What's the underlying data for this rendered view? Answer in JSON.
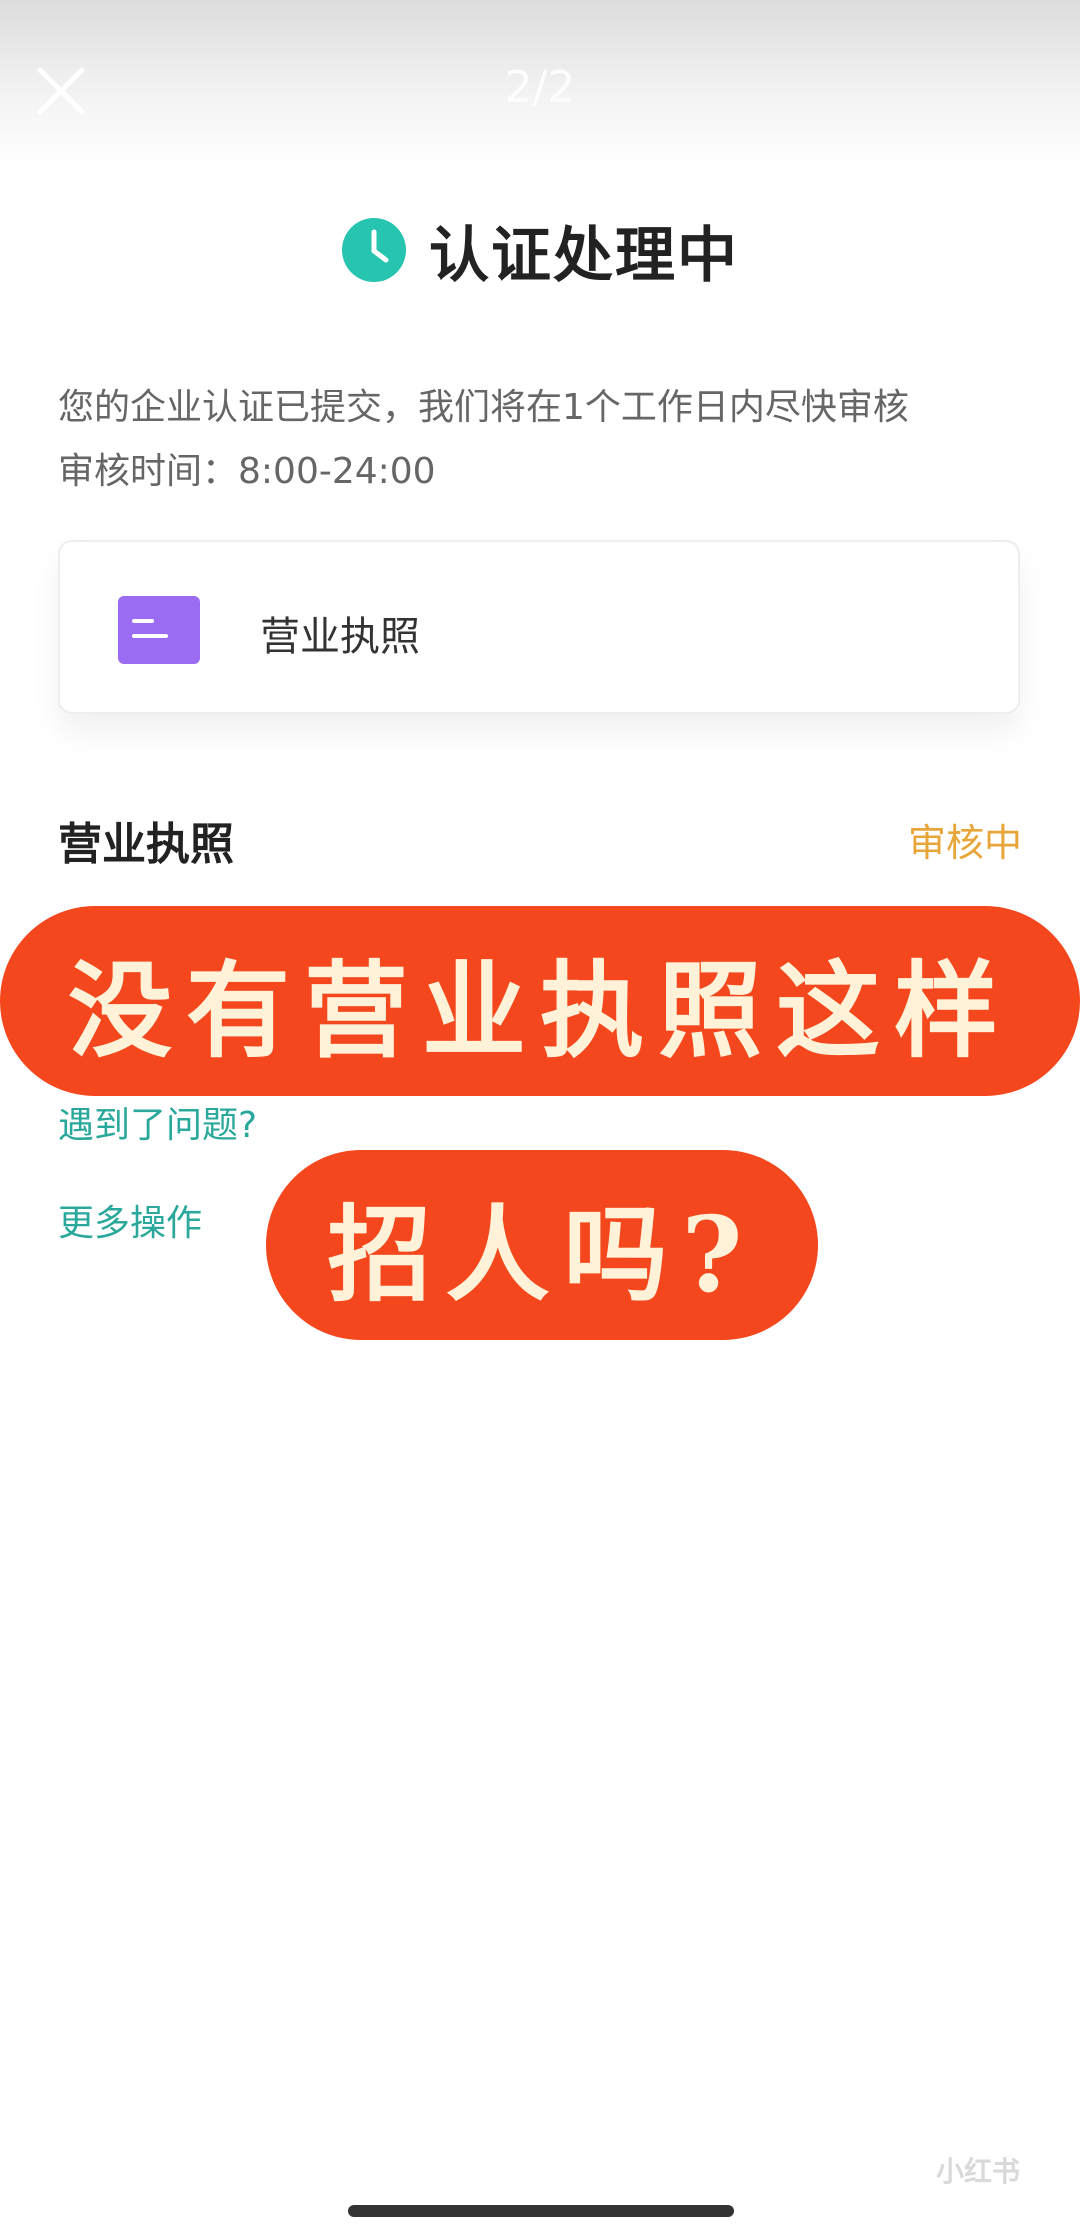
{
  "header": {
    "close_icon": "close-icon",
    "page_counter": "2/2"
  },
  "status_card": {
    "title": "认证处理中",
    "title_icon": "clock-icon",
    "accent_color": "#27c4b0",
    "description": "您的企业认证已提交，我们将在1个工作日内尽快审核",
    "review_hours": "审核时间：8:00-24:00"
  },
  "document": {
    "icon": "document-icon",
    "icon_color": "#9b6cf2",
    "label": "营业执照"
  },
  "section": {
    "title": "营业执照",
    "status": "审核中",
    "status_color": "#e8a63a"
  },
  "links": {
    "help": "遇到了问题?",
    "more": "更多操作",
    "link_color": "#2aa89b"
  },
  "overlay": {
    "line1": "没有营业执照这样",
    "line2": "招人吗?",
    "bg_color": "#f4471d",
    "text_color": "#fff2d8"
  },
  "watermark": "小红书"
}
